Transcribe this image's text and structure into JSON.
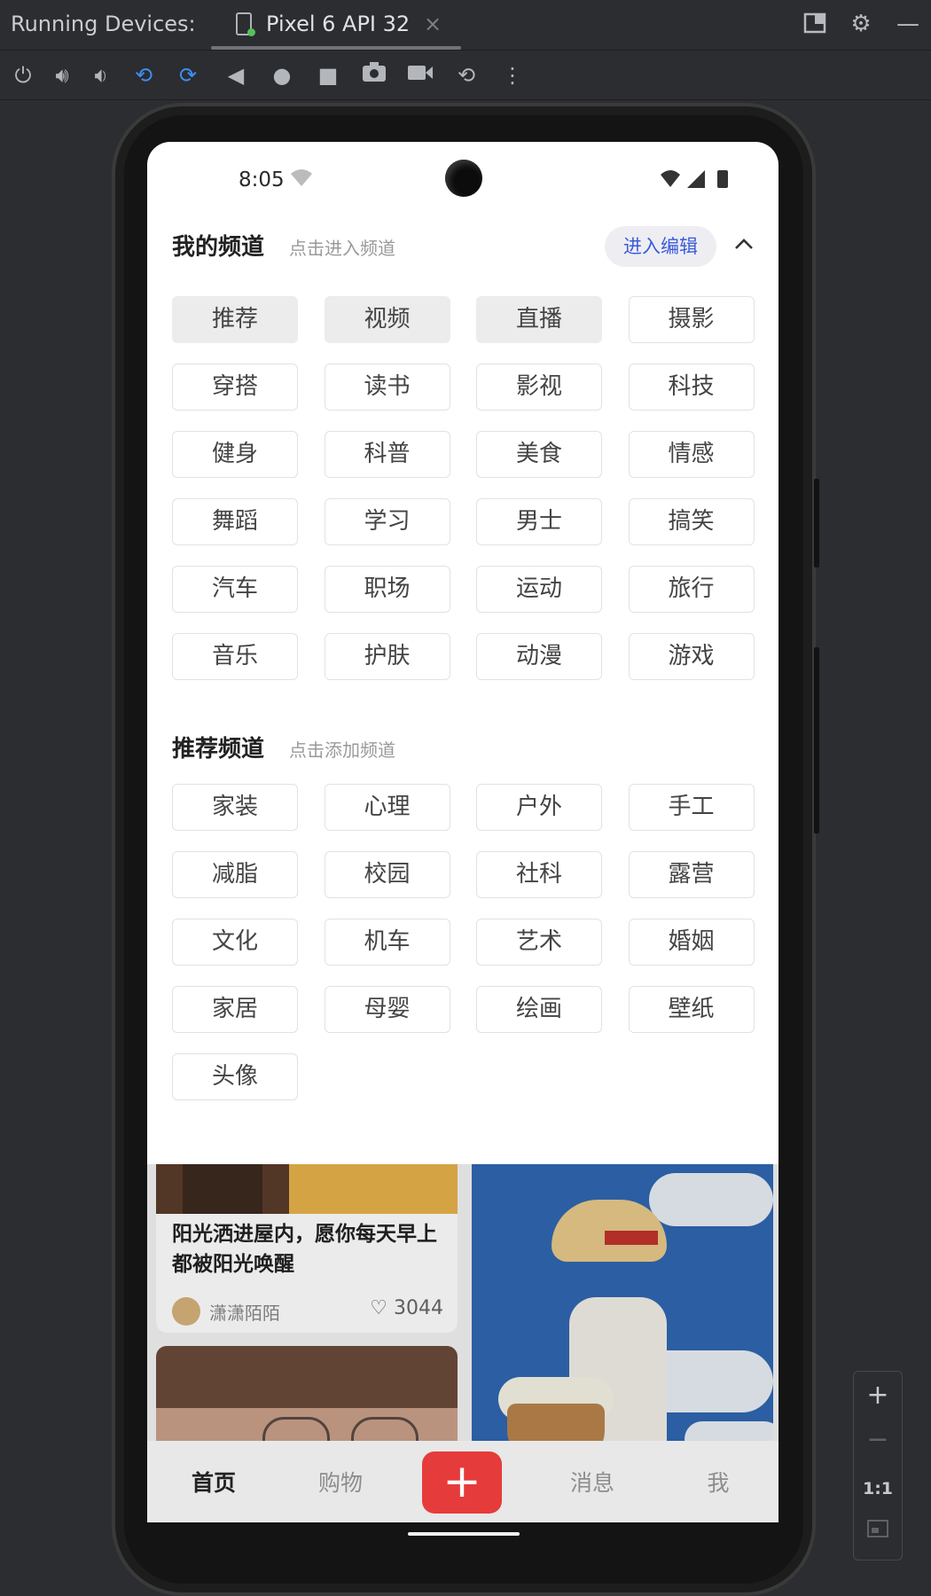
{
  "ide": {
    "title": "Running Devices:",
    "tab_label": "Pixel 6 API 32",
    "tab_close": "×",
    "right_icons": [
      "layout-icon",
      "gear-icon",
      "minimize-icon"
    ],
    "toolbar_icons": [
      "power-icon",
      "volume-up-icon",
      "volume-down-icon",
      "rotate-left-icon",
      "rotate-right-icon",
      "back-icon",
      "home-icon",
      "overview-icon",
      "screenshot-icon",
      "screen-record-icon",
      "snapshot-icon",
      "more-icon"
    ]
  },
  "zoom": {
    "plus": "+",
    "minus": "−",
    "actual": "1:1"
  },
  "status": {
    "time": "8:05",
    "wifi_q": "?"
  },
  "my_channels": {
    "title": "我的频道",
    "hint": "点击进入频道",
    "edit_label": "进入编辑",
    "collapse": "^",
    "items": [
      {
        "label": "推荐",
        "filled": true
      },
      {
        "label": "视频",
        "filled": true
      },
      {
        "label": "直播",
        "filled": true
      },
      {
        "label": "摄影",
        "filled": false
      },
      {
        "label": "穿搭",
        "filled": false
      },
      {
        "label": "读书",
        "filled": false
      },
      {
        "label": "影视",
        "filled": false
      },
      {
        "label": "科技",
        "filled": false
      },
      {
        "label": "健身",
        "filled": false
      },
      {
        "label": "科普",
        "filled": false
      },
      {
        "label": "美食",
        "filled": false
      },
      {
        "label": "情感",
        "filled": false
      },
      {
        "label": "舞蹈",
        "filled": false
      },
      {
        "label": "学习",
        "filled": false
      },
      {
        "label": "男士",
        "filled": false
      },
      {
        "label": "搞笑",
        "filled": false
      },
      {
        "label": "汽车",
        "filled": false
      },
      {
        "label": "职场",
        "filled": false
      },
      {
        "label": "运动",
        "filled": false
      },
      {
        "label": "旅行",
        "filled": false
      },
      {
        "label": "音乐",
        "filled": false
      },
      {
        "label": "护肤",
        "filled": false
      },
      {
        "label": "动漫",
        "filled": false
      },
      {
        "label": "游戏",
        "filled": false
      }
    ]
  },
  "recommended_channels": {
    "title": "推荐频道",
    "hint": "点击添加频道",
    "items": [
      "家装",
      "心理",
      "户外",
      "手工",
      "减脂",
      "校园",
      "社科",
      "露营",
      "文化",
      "机车",
      "艺术",
      "婚姻",
      "家居",
      "母婴",
      "绘画",
      "壁纸",
      "头像"
    ]
  },
  "feed": {
    "card_title": "阳光洒进屋内，愿你每天早上都被阳光唤醒",
    "author": "潇潇陌陌",
    "likes_icon": "♡",
    "likes": "3044"
  },
  "bottom_nav": {
    "home": "首页",
    "shop": "购物",
    "plus": "+",
    "messages": "消息",
    "me": "我"
  }
}
